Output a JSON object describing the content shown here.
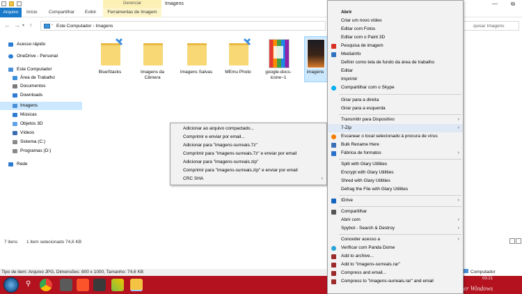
{
  "titlebar": {
    "manage_label": "Gerenciar",
    "window_title": "Imagens",
    "minimize": "—",
    "restore": "⧉"
  },
  "ribbon": {
    "tabs": [
      "Arquivo",
      "Início",
      "Compartilhar",
      "Exibir"
    ],
    "contextual_tab": "Ferramentas de Imagem"
  },
  "address": {
    "path": [
      "Este Computador",
      "Imagens"
    ],
    "search_placeholder": "quisar Imagens"
  },
  "nav": {
    "items": [
      {
        "label": "Acesso rápido",
        "color": "#2b7cd3"
      },
      {
        "label": "OneDrive - Personal",
        "color": "#2b7cd3"
      },
      {
        "label": "Este Computador",
        "color": "#4a90d9"
      },
      {
        "label": "Área de Trabalho",
        "color": "#3a8fd9"
      },
      {
        "label": "Documentos",
        "color": "#7a7a7a"
      },
      {
        "label": "Downloads",
        "color": "#2e7bd1"
      },
      {
        "label": "Imagens",
        "color": "#4a90d9"
      },
      {
        "label": "Músicas",
        "color": "#2e7bd1"
      },
      {
        "label": "Objetos 3D",
        "color": "#5fa3e6"
      },
      {
        "label": "Vídeos",
        "color": "#3d6cb3"
      },
      {
        "label": "Sistema (C:)",
        "color": "#8a8a8a"
      },
      {
        "label": "Programas (D:)",
        "color": "#8a8a8a"
      },
      {
        "label": "Rede",
        "color": "#2e7bd1"
      }
    ]
  },
  "files": [
    {
      "name": "BlueStacks",
      "kind": "folder-blue-badge"
    },
    {
      "name": "Imagens da Câmera",
      "kind": "folder"
    },
    {
      "name": "Imagens Salvas",
      "kind": "folder"
    },
    {
      "name": "MEmu Photo",
      "kind": "folder-blue-badge"
    },
    {
      "name": "google-docs-icone~1",
      "kind": "image-colorful"
    },
    {
      "name": "imagens",
      "kind": "image-selected"
    }
  ],
  "status": {
    "items_count": "7 itens",
    "selected": "1 item selecionado  74,6 KB",
    "details": "Tipo de item: Arquivo JPG, Dimensões: 800 x 1000, Tamanho: 74,6 KB",
    "computer_label": "Computador"
  },
  "taskbar": {
    "time": "03:21",
    "watermark": "er Windows"
  },
  "submenu": {
    "items": [
      "Adicionar ao arquivo compactado...",
      "Comprimir e enviar por email...",
      "Adicionar para \"imagens-surreais.7z\"",
      "Comprimir para \"imagens-surreais.7z\" e enviar por email",
      "Adicionar para \"imagens-surreais.zip\"",
      "Comprimir para \"imagens-surreais.zip\" e enviar por email",
      "CRC SHA"
    ]
  },
  "context_menu": {
    "items": [
      {
        "label": "Abrir",
        "bold": true
      },
      {
        "label": "Criar um novo vídeo"
      },
      {
        "label": "Editar com Fotos"
      },
      {
        "label": "Editar com o Paint 3D"
      },
      {
        "label": "Pesquisa de imagem",
        "icon": "#d93025"
      },
      {
        "label": "MediaInfo",
        "icon": "#2f74c0"
      },
      {
        "label": "Definir como tela de fundo da área de trabalho"
      },
      {
        "label": "Editar"
      },
      {
        "label": "Imprimir"
      },
      {
        "label": "Compartilhar com o Skype",
        "icon": "#00aff0"
      },
      {
        "sep": true
      },
      {
        "label": "Girar para a direita"
      },
      {
        "label": "Girar para a esquerda"
      },
      {
        "sep": true
      },
      {
        "label": "Transmitir para Dispositivo",
        "sub": true
      },
      {
        "label": "7-Zip",
        "sub": true
      },
      {
        "label": "Escanear o local selecionado à procura de vírus",
        "icon": "#f57c00"
      },
      {
        "label": "Bulk Rename Here",
        "icon": "#3b6fb6"
      },
      {
        "label": "Fábrica de formatos",
        "icon": "#2a72c9",
        "sub": true
      },
      {
        "sep": true
      },
      {
        "label": "Split with Glary Utilities"
      },
      {
        "label": "Encrypt with Glary Utilities"
      },
      {
        "label": "Shred with Glary Utilities"
      },
      {
        "label": "Defrag the File with Glary Utilities"
      },
      {
        "sep": true
      },
      {
        "label": "IDrive",
        "icon": "#1565c0",
        "sub": true
      },
      {
        "sep": true
      },
      {
        "label": "Compartilhar",
        "icon": "#555555"
      },
      {
        "label": "Abrir com",
        "sub": true
      },
      {
        "label": "Spybot - Search & Destroy",
        "sub": true
      },
      {
        "sep": true
      },
      {
        "label": "Conceder acesso a",
        "sub": true
      },
      {
        "label": "Verificar com Panda Dome",
        "icon": "#2aa3d9"
      },
      {
        "label": "Add to archive...",
        "icon": "#9c2a2a"
      },
      {
        "label": "Add to \"imagens-surreais.rar\"",
        "icon": "#9c2a2a"
      },
      {
        "label": "Compress and email...",
        "icon": "#9c2a2a"
      },
      {
        "label": "Compress to \"imagens-surreais.rar\" and email",
        "icon": "#9c2a2a"
      }
    ]
  }
}
